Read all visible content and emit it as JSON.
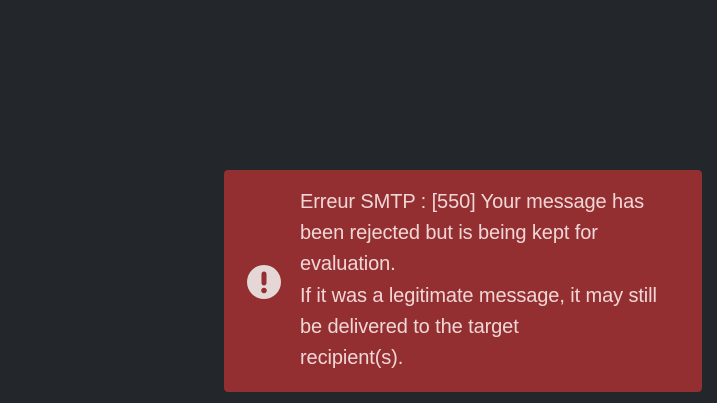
{
  "colors": {
    "background": "#23272b",
    "toast_background": "#942f31",
    "toast_text": "#f0d6d6",
    "icon_fill": "#e6d7d7",
    "icon_glyph": "#942f31"
  },
  "toast": {
    "type": "error",
    "icon": "exclamation-circle-icon",
    "lines": [
      "Erreur SMTP : [550] Your message has",
      "been rejected but is being kept for",
      "evaluation.",
      "If it was a legitimate message, it may still",
      "be delivered to the target",
      "recipient(s)."
    ]
  }
}
